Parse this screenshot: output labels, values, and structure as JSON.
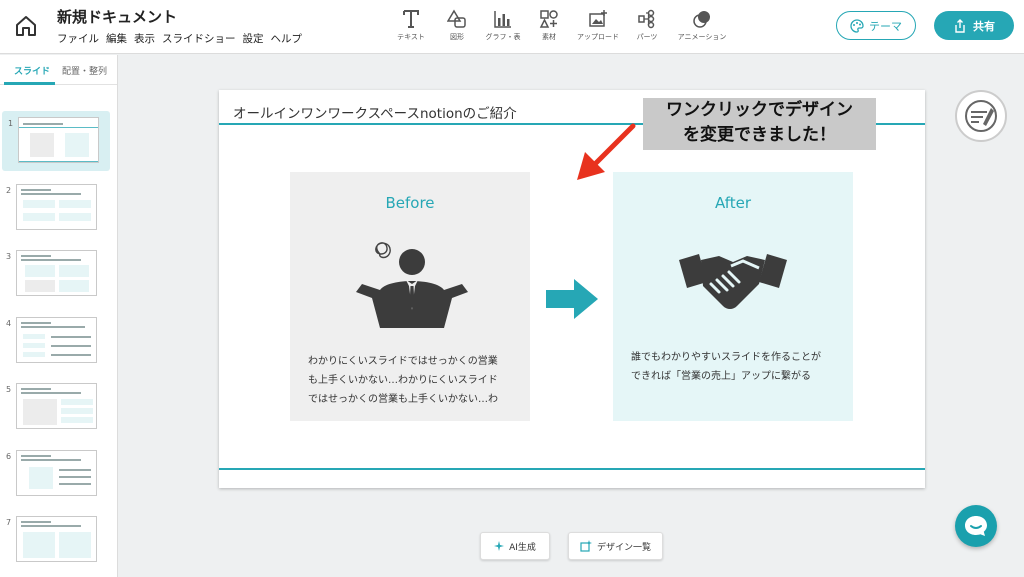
{
  "header": {
    "title": "新規ドキュメント",
    "menu": [
      "ファイル",
      "編集",
      "表示",
      "スライドショー",
      "設定",
      "ヘルプ"
    ],
    "tools": [
      {
        "icon": "text-icon",
        "label": "テキスト"
      },
      {
        "icon": "shape-icon",
        "label": "図形"
      },
      {
        "icon": "chart-icon",
        "label": "グラフ・表"
      },
      {
        "icon": "material-icon",
        "label": "素材"
      },
      {
        "icon": "upload-icon",
        "label": "アップロード"
      },
      {
        "icon": "parts-icon",
        "label": "パーツ"
      },
      {
        "icon": "animation-icon",
        "label": "アニメーション"
      }
    ],
    "theme_label": "テーマ",
    "share_label": "共有"
  },
  "sidebar": {
    "tabs": [
      "スライド",
      "配置・整列"
    ],
    "active_tab": "スライド",
    "thumbnails": [
      "1",
      "2",
      "3",
      "4",
      "5",
      "6",
      "7"
    ],
    "selected": "1"
  },
  "slide": {
    "title": "オールインワンワークスペースnotionのご紹介",
    "before": {
      "heading": "Before",
      "lines": [
        "わかりにくいスライドではせっかくの営業",
        "も上手くいかない…わかりにくいスライド",
        "ではせっかくの営業も上手くいかない…わ"
      ]
    },
    "after": {
      "heading": "After",
      "lines": [
        "誰でもわかりやすいスライドを作ることが",
        "できれば「営業の売上」アップに繋がる"
      ]
    }
  },
  "callout": {
    "line1": "ワンクリックでデザイン",
    "line2": "を変更できました！"
  },
  "bottom": {
    "ai_label": "AI生成",
    "design_label": "デザイン一覧"
  },
  "colors": {
    "accent": "#26a7b5",
    "callout_bg": "#c9c9c9",
    "red_arrow": "#e8321e"
  }
}
